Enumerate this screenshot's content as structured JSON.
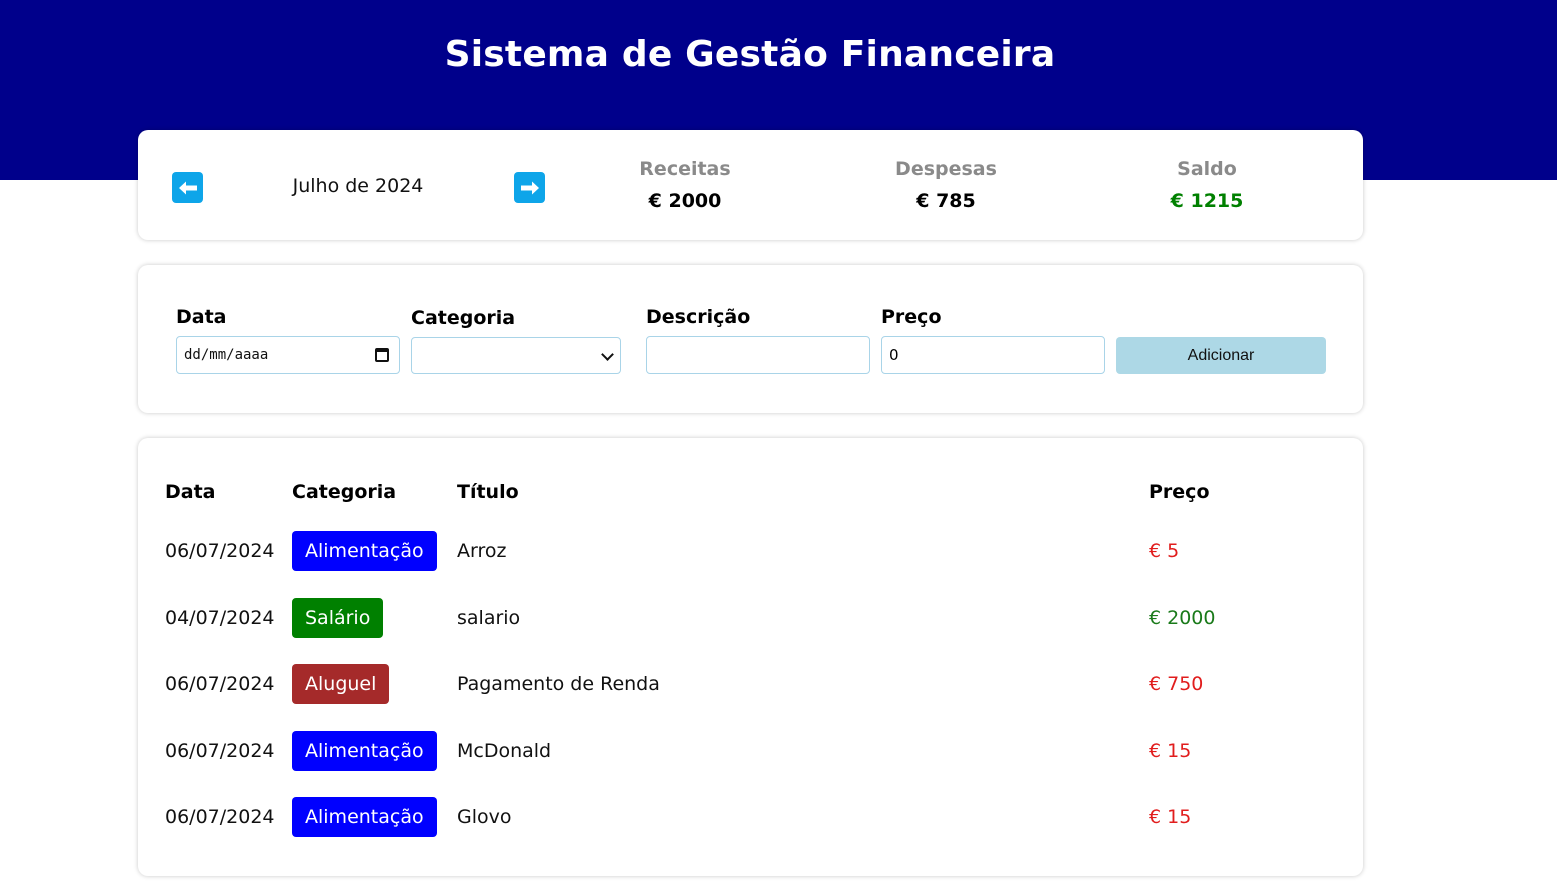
{
  "header": {
    "title": "Sistema de Gestão Financeira",
    "bg_color": "#00008b"
  },
  "summary": {
    "prev_icon": "arrow-left-icon",
    "next_icon": "arrow-right-icon",
    "month": "Julho de 2024",
    "income": {
      "label": "Receitas",
      "value": "€ 2000"
    },
    "expenses": {
      "label": "Despesas",
      "value": "€ 785"
    },
    "balance": {
      "label": "Saldo",
      "value": "€ 1215",
      "color": "#008000"
    }
  },
  "form": {
    "date": {
      "label": "Data",
      "placeholder": "dd/mm/aaaa"
    },
    "category": {
      "label": "Categoria",
      "value": ""
    },
    "description": {
      "label": "Descrição",
      "value": ""
    },
    "price": {
      "label": "Preço",
      "value": "0"
    },
    "add_button": "Adicionar"
  },
  "table": {
    "headers": {
      "date": "Data",
      "category": "Categoria",
      "title": "Título",
      "price": "Preço"
    },
    "rows": [
      {
        "date": "06/07/2024",
        "category": "Alimentação",
        "category_color": "#0000ff",
        "title": "Arroz",
        "price": "€ 5",
        "type": "expense"
      },
      {
        "date": "04/07/2024",
        "category": "Salário",
        "category_color": "#008000",
        "title": "salario",
        "price": "€ 2000",
        "type": "income"
      },
      {
        "date": "06/07/2024",
        "category": "Aluguel",
        "category_color": "#a52a2a",
        "title": "Pagamento de Renda",
        "price": "€ 750",
        "type": "expense"
      },
      {
        "date": "06/07/2024",
        "category": "Alimentação",
        "category_color": "#0000ff",
        "title": "McDonald",
        "price": "€ 15",
        "type": "expense"
      },
      {
        "date": "06/07/2024",
        "category": "Alimentação",
        "category_color": "#0000ff",
        "title": "Glovo",
        "price": "€ 15",
        "type": "expense"
      }
    ]
  }
}
